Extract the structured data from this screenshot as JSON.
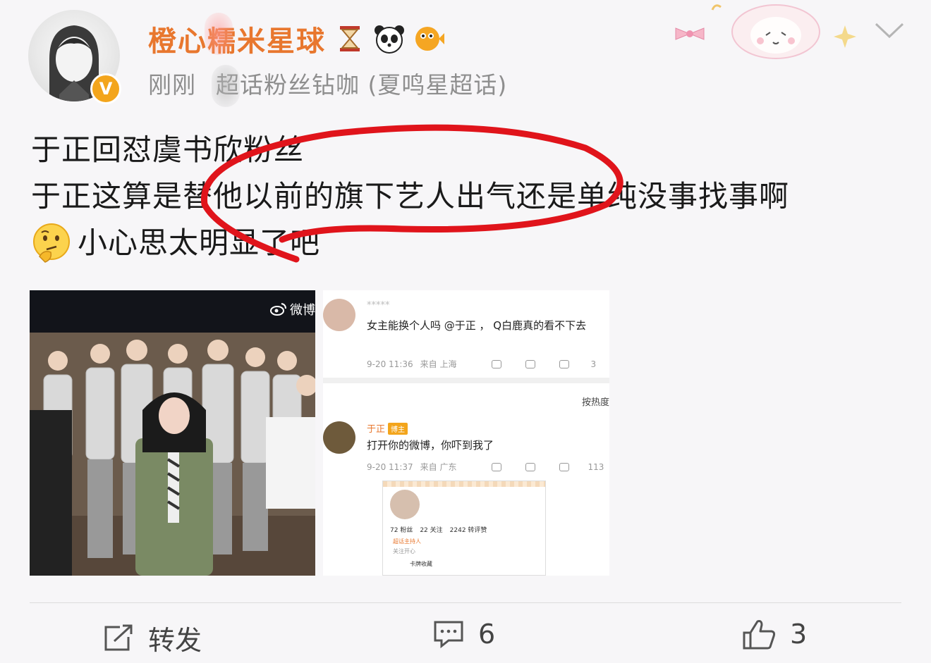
{
  "post": {
    "username": "橙心糯米星球",
    "badges": [
      "hourglass-icon",
      "panda-icon",
      "pufferfish-icon"
    ],
    "timestamp": "刚刚",
    "source": "超话粉丝钻咖 (夏鸣星超话)",
    "verified_badge": "V",
    "text_lines": [
      "于正回怼虞书欣粉丝",
      "于正这算是替他以前的旗下艺人出气还是单纯没事找事啊",
      "小心思太明显了吧"
    ]
  },
  "video": {
    "watermark": "微博"
  },
  "comment_screenshot": {
    "sort_label": "按热度",
    "comment1": {
      "name": "*****",
      "text": "女主能换个人吗 @于正 ， Q白鹿真的看不下去",
      "time": "9-20 11:36",
      "location": "来自 上海",
      "likes": "3"
    },
    "comment2": {
      "name": "于正",
      "tag": "博主",
      "text": "打开你的微博，你吓到我了",
      "time": "9-20 11:37",
      "location": "来自 广东",
      "likes": "113"
    },
    "profile": {
      "fans": "72 粉丝",
      "follows": "22 关注",
      "likes": "2242 转评赞",
      "line1": "超话主持人",
      "line2": "关注开心",
      "line3": "卡牌收藏"
    }
  },
  "actions": {
    "repost_label": "转发",
    "comment_count": "6",
    "like_count": "3"
  },
  "colors": {
    "username": "#e8772e",
    "circle": "#e0141b",
    "badge": "#f3a51c"
  }
}
